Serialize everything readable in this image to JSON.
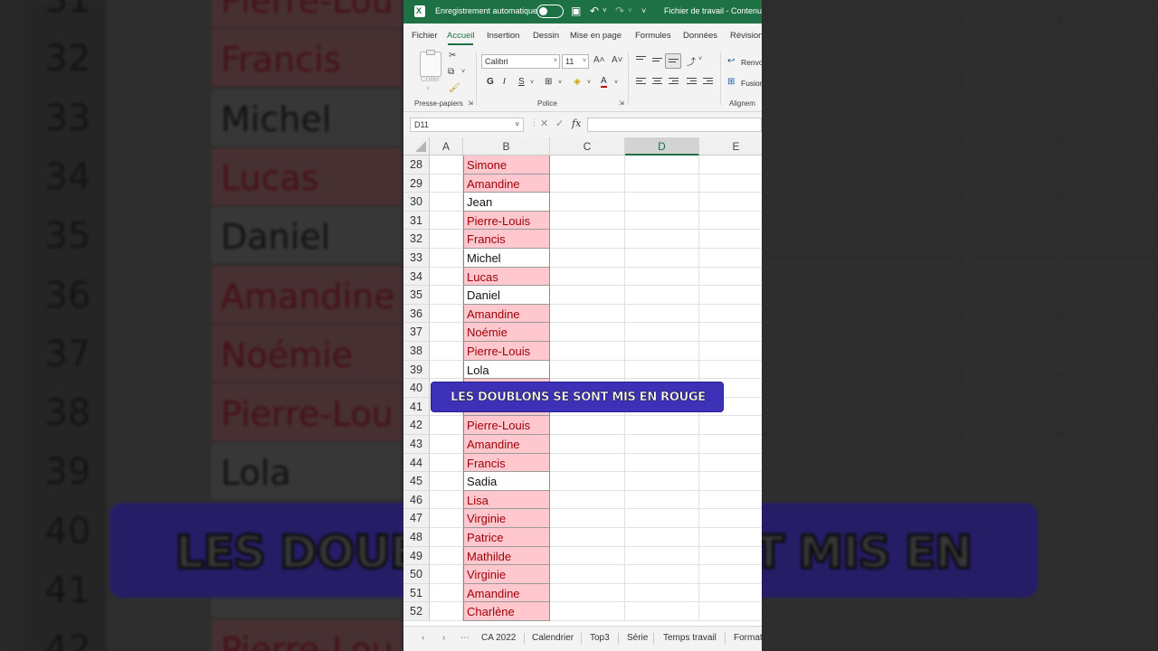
{
  "titlebar": {
    "autosave_label": "Enregistrement automatique",
    "doc_title": "Fichier de travail - Contenu ˅"
  },
  "tabs": [
    "Fichier",
    "Accueil",
    "Insertion",
    "Dessin",
    "Mise en page",
    "Formules",
    "Données",
    "Révision"
  ],
  "active_tab": "Accueil",
  "ribbon": {
    "paste_label": "Coller",
    "clipboard_group": "Presse-papiers",
    "font_name": "Calibri",
    "font_size": "11",
    "grow_font": "A˄",
    "shrink_font": "A˅",
    "bold": "G",
    "italic": "I",
    "underline": "S",
    "font_group": "Police",
    "wrap_label": "Renvo",
    "merge_label": "Fusion",
    "align_group": "Alignem"
  },
  "formula_bar": {
    "name_box": "D11",
    "fx": "fx",
    "formula": ""
  },
  "columns": [
    "A",
    "B",
    "C",
    "D",
    "E"
  ],
  "selected_column": "D",
  "rows": [
    {
      "n": "28",
      "name": "Simone",
      "dup": true
    },
    {
      "n": "29",
      "name": "Amandine",
      "dup": true
    },
    {
      "n": "30",
      "name": "Jean",
      "dup": false
    },
    {
      "n": "31",
      "name": "Pierre-Louis",
      "dup": true
    },
    {
      "n": "32",
      "name": "Francis",
      "dup": true
    },
    {
      "n": "33",
      "name": "Michel",
      "dup": false
    },
    {
      "n": "34",
      "name": "Lucas",
      "dup": true
    },
    {
      "n": "35",
      "name": "Daniel",
      "dup": false
    },
    {
      "n": "36",
      "name": "Amandine",
      "dup": true
    },
    {
      "n": "37",
      "name": "Noémie",
      "dup": true
    },
    {
      "n": "38",
      "name": "Pierre-Louis",
      "dup": true
    },
    {
      "n": "39",
      "name": "Lola",
      "dup": false
    },
    {
      "n": "40",
      "name": "",
      "dup": true
    },
    {
      "n": "41",
      "name": "",
      "dup": true
    },
    {
      "n": "42",
      "name": "Pierre-Louis",
      "dup": true
    },
    {
      "n": "43",
      "name": "Amandine",
      "dup": true
    },
    {
      "n": "44",
      "name": "Francis",
      "dup": true
    },
    {
      "n": "45",
      "name": "Sadia",
      "dup": false
    },
    {
      "n": "46",
      "name": "Lisa",
      "dup": true
    },
    {
      "n": "47",
      "name": "Virginie",
      "dup": true
    },
    {
      "n": "48",
      "name": "Patrice",
      "dup": true
    },
    {
      "n": "49",
      "name": "Mathilde",
      "dup": true
    },
    {
      "n": "50",
      "name": "Virginie",
      "dup": true
    },
    {
      "n": "51",
      "name": "Amandine",
      "dup": true
    },
    {
      "n": "52",
      "name": "Charlène",
      "dup": true
    }
  ],
  "background_rows": [
    {
      "n": "31",
      "name": "Pierre-Lou",
      "dup": true
    },
    {
      "n": "32",
      "name": "Francis",
      "dup": true
    },
    {
      "n": "33",
      "name": "Michel",
      "dup": false
    },
    {
      "n": "34",
      "name": "Lucas",
      "dup": true
    },
    {
      "n": "35",
      "name": "Daniel",
      "dup": false
    },
    {
      "n": "36",
      "name": "Amandine",
      "dup": true
    },
    {
      "n": "37",
      "name": "Noémie",
      "dup": true
    },
    {
      "n": "38",
      "name": "Pierre-Lou",
      "dup": true
    },
    {
      "n": "39",
      "name": "Lola",
      "dup": false
    },
    {
      "n": "40",
      "name": "",
      "dup": false
    },
    {
      "n": "41",
      "name": "",
      "dup": false
    },
    {
      "n": "42",
      "name": "Pierre-Lou",
      "dup": true
    }
  ],
  "sheet_tabs": [
    "CA 2022",
    "Calendrier",
    "Top3",
    "Série",
    "Temps travail",
    "Format"
  ],
  "caption": "LES DOUBLONS SE SONT MIS EN ROUGE",
  "background_caption": "LES DOUBLONS SE SONT MIS EN ROUGE",
  "colors": {
    "excel_green": "#1e7145",
    "dup_fill": "#ffc7ce",
    "dup_text": "#9c0006",
    "caption_bg": "#3d31b8"
  }
}
